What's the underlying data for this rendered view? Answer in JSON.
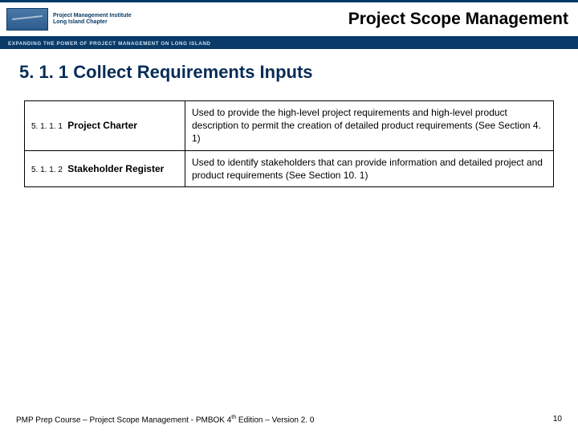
{
  "header": {
    "org_line1": "Project Management Institute",
    "org_line2": "Long Island Chapter",
    "tagline": "EXPANDING THE POWER OF PROJECT MANAGEMENT ON LONG ISLAND",
    "page_title": "Project Scope Management"
  },
  "section": {
    "heading": "5. 1. 1 Collect Requirements Inputs"
  },
  "table": {
    "rows": [
      {
        "num": "5. 1. 1. 1",
        "name": "Project Charter",
        "desc": "Used to provide the high-level project requirements and high-level product description to permit the creation of detailed product requirements (See Section 4. 1)"
      },
      {
        "num": "5. 1. 1. 2",
        "name": "Stakeholder Register",
        "desc": "Used to identify stakeholders that can provide information and detailed project and product requirements (See Section 10. 1)"
      }
    ]
  },
  "footer": {
    "text_pre": "PMP Prep Course – Project Scope Management - PMBOK 4",
    "text_sup": "th",
    "text_post": " Edition – Version 2. 0",
    "page_number": "10"
  }
}
